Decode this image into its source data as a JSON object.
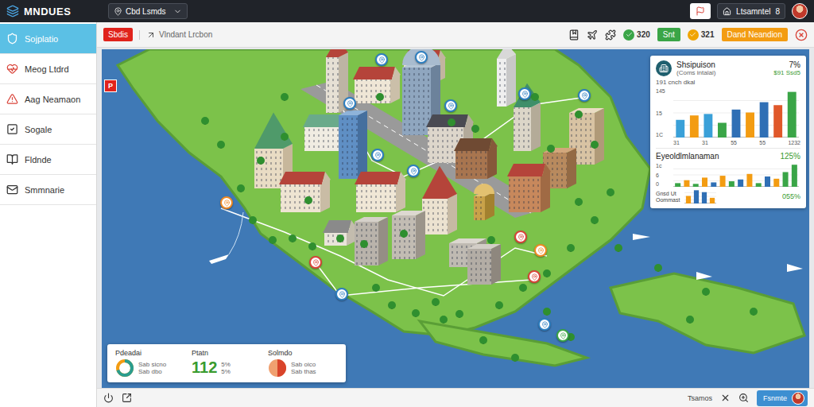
{
  "app": {
    "logo": "MNDUES",
    "workspace": "Cbd Lsmds",
    "user": "Ltsamntel",
    "user_count": "8"
  },
  "sidebar": {
    "items": [
      {
        "label": "Sojplatio",
        "selected": true
      },
      {
        "label": "Meog Ltdrd",
        "selected": false
      },
      {
        "label": "Aag Neamaon",
        "selected": false
      },
      {
        "label": "Sogale",
        "selected": false
      },
      {
        "label": "Fldnde",
        "selected": false
      },
      {
        "label": "Smmnarie",
        "selected": false
      }
    ]
  },
  "toolbar": {
    "button": "Sbdis",
    "location": "Vlndant Lrcbon",
    "items": [
      {
        "kind": "counter",
        "label": "320",
        "color": "#3aa547"
      },
      {
        "kind": "button",
        "label": "Snt",
        "color": "#3aa547"
      },
      {
        "kind": "counter",
        "label": "321",
        "color": "#f0a400"
      },
      {
        "kind": "button",
        "label": "Dand Neandion",
        "color": "#f39c12"
      }
    ]
  },
  "map": {
    "flag": "P",
    "pins": [
      {
        "color": "#f08a24"
      },
      {
        "color": "#2d7fc1"
      },
      {
        "color": "#2d7fc1"
      },
      {
        "color": "#2d7fc1"
      },
      {
        "color": "#2d7fc1"
      },
      {
        "color": "#2d7fc1"
      },
      {
        "color": "#2d7fc1"
      },
      {
        "color": "#2d7fc1"
      },
      {
        "color": "#2d7fc1"
      },
      {
        "color": "#d9443a"
      },
      {
        "color": "#2d7fc1"
      },
      {
        "color": "#d9443a"
      },
      {
        "color": "#f08a24"
      },
      {
        "color": "#d9443a"
      },
      {
        "color": "#2d7fc1"
      },
      {
        "color": "#3aa547"
      }
    ]
  },
  "summary_panel": {
    "title": "Shsipuison",
    "subtitle": "(Coms intalai)",
    "change": "7%",
    "sub_value": "$91 Ssd5",
    "axis_label": "191 cnch dkal",
    "y_ticks": [
      "145",
      "15",
      "1C"
    ],
    "x_ticks": [
      "31",
      "31",
      "55",
      "55",
      "1232"
    ],
    "values": [
      60,
      75,
      80,
      50,
      95,
      85,
      120,
      110,
      155
    ],
    "colors": [
      "#3aa0d8",
      "#f39c12",
      "#3aa0d8",
      "#3aa547",
      "#2f6fb5",
      "#f39c12",
      "#2f6fb5",
      "#e0582a",
      "#3aa547"
    ]
  },
  "breakdown_panel": {
    "title": "Eyeoldlmlanaman",
    "change": "125%",
    "y_ticks": [
      "1c",
      "6",
      "0"
    ],
    "values": [
      10,
      18,
      8,
      25,
      12,
      30,
      15,
      20,
      35,
      10,
      28,
      22,
      40,
      60
    ],
    "colors": [
      "#3aa547",
      "#f39c12",
      "#3aa547",
      "#f39c12",
      "#2f6fb5",
      "#f39c12",
      "#3aa547",
      "#2f6fb5",
      "#f39c12",
      "#3aa547",
      "#2f6fb5",
      "#f39c12",
      "#3aa547",
      "#3aa547"
    ],
    "legend": [
      "Gnsd Ut",
      "Oommast"
    ],
    "mini_values": [
      20,
      35,
      30,
      15
    ],
    "mini_colors": [
      "#f39c12",
      "#2f6fb5",
      "#2f6fb5",
      "#f39c12"
    ],
    "mini_change": "055%"
  },
  "stats_card": {
    "items": [
      {
        "kind": "donut",
        "label": "Pdeadai",
        "level": 0.7,
        "lines": [
          "Sab sicno",
          "Sab dbo"
        ]
      },
      {
        "kind": "number",
        "label": "Ptatn",
        "value": "112",
        "lines": [
          "5%",
          "5%"
        ]
      },
      {
        "kind": "pie",
        "label": "Solmdo",
        "level": 0.5,
        "lines": [
          "Sab oico",
          "Sab thas"
        ]
      }
    ]
  },
  "footer": {
    "label": "Tsamos",
    "button": "Fsnmte"
  }
}
